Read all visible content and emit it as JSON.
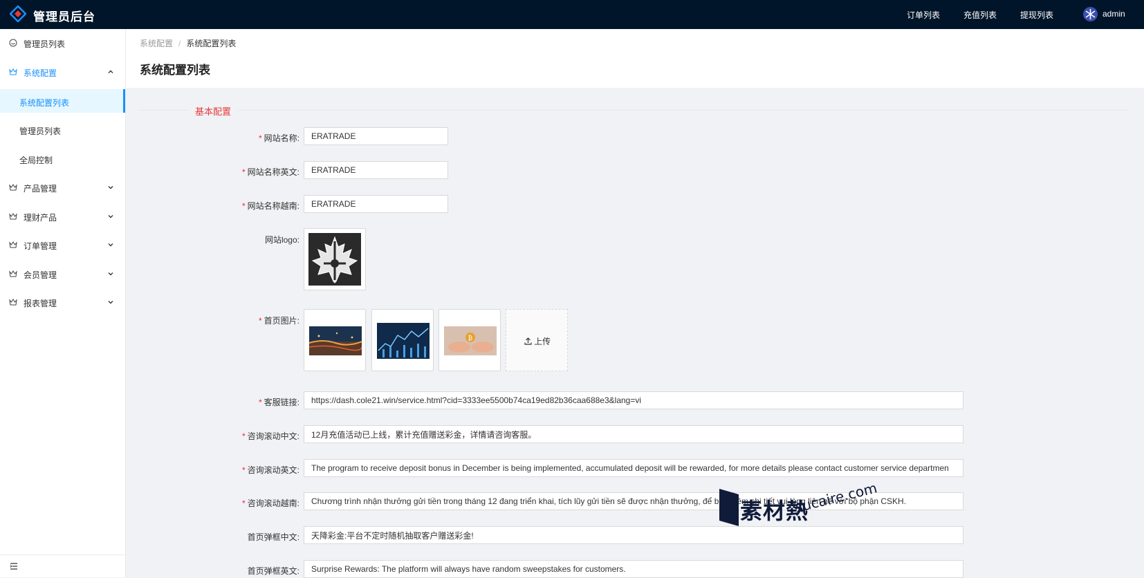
{
  "header": {
    "app_title": "管理员后台",
    "nav": [
      "订单列表",
      "充值列表",
      "提现列表"
    ],
    "username": "admin"
  },
  "sidebar": {
    "items": [
      {
        "label": "管理员列表",
        "icon": "smile-icon"
      },
      {
        "label": "系统配置",
        "icon": "crown-icon",
        "expanded": true,
        "children": [
          "系统配置列表",
          "管理员列表",
          "全局控制"
        ]
      },
      {
        "label": "产品管理",
        "icon": "crown-icon"
      },
      {
        "label": "理财产品",
        "icon": "crown-icon"
      },
      {
        "label": "订单管理",
        "icon": "crown-icon"
      },
      {
        "label": "会员管理",
        "icon": "crown-icon"
      },
      {
        "label": "报表管理",
        "icon": "crown-icon"
      }
    ],
    "active_child": "系统配置列表"
  },
  "breadcrumb": {
    "parent": "系统配置",
    "separator": "/",
    "current": "系统配置列表"
  },
  "page_title": "系统配置列表",
  "section_title": "基本配置",
  "form": {
    "site_name": {
      "label": "网站名称:",
      "value": "ERATRADE",
      "required": true
    },
    "site_name_en": {
      "label": "网站名称英文:",
      "value": "ERATRADE",
      "required": true
    },
    "site_name_vi": {
      "label": "网站名称越南:",
      "value": "ERATRADE",
      "required": true
    },
    "logo": {
      "label": "网站logo:",
      "required": false
    },
    "home_images": {
      "label": "首页图片:",
      "required": true,
      "upload_label": "上传"
    },
    "service_link": {
      "label": "客服链接:",
      "value": "https://dash.cole21.win/service.html?cid=3333ee5500b74ca19ed82b36caa688e3&lang=vi",
      "required": true
    },
    "scroll_cn": {
      "label": "咨询滚动中文:",
      "value": "12月充值活动已上线，累计充值赠送彩金，详情请咨询客服。",
      "required": true
    },
    "scroll_en": {
      "label": "咨询滚动英文:",
      "value": "The program to receive deposit bonus in December is being implemented, accumulated deposit will be rewarded, for more details please contact customer service departmen",
      "required": true
    },
    "scroll_vi": {
      "label": "咨询滚动越南:",
      "value": "Chương trình nhận thưởng gửi tiền trong tháng 12 đang triển khai, tích lũy gửi tiền sẽ được nhận thưởng, để biết thêm chi tiết vui lòng liên hệ với bộ phận CSKH.",
      "required": true
    },
    "popup_cn": {
      "label": "首页弹框中文:",
      "value": "天降彩金:平台不定时随机抽取客户赠送彩金!",
      "required": false
    },
    "popup_en": {
      "label": "首页弹框英文:",
      "value": "Surprise Rewards: The platform will always have random sweepstakes for customers.",
      "required": false
    }
  },
  "watermark": {
    "cn": "素材熱",
    "en": "sucaire.com"
  },
  "colors": {
    "topbar": "#001529",
    "accent": "#1890ff",
    "required": "#f5222d",
    "section": "#e8393a"
  }
}
